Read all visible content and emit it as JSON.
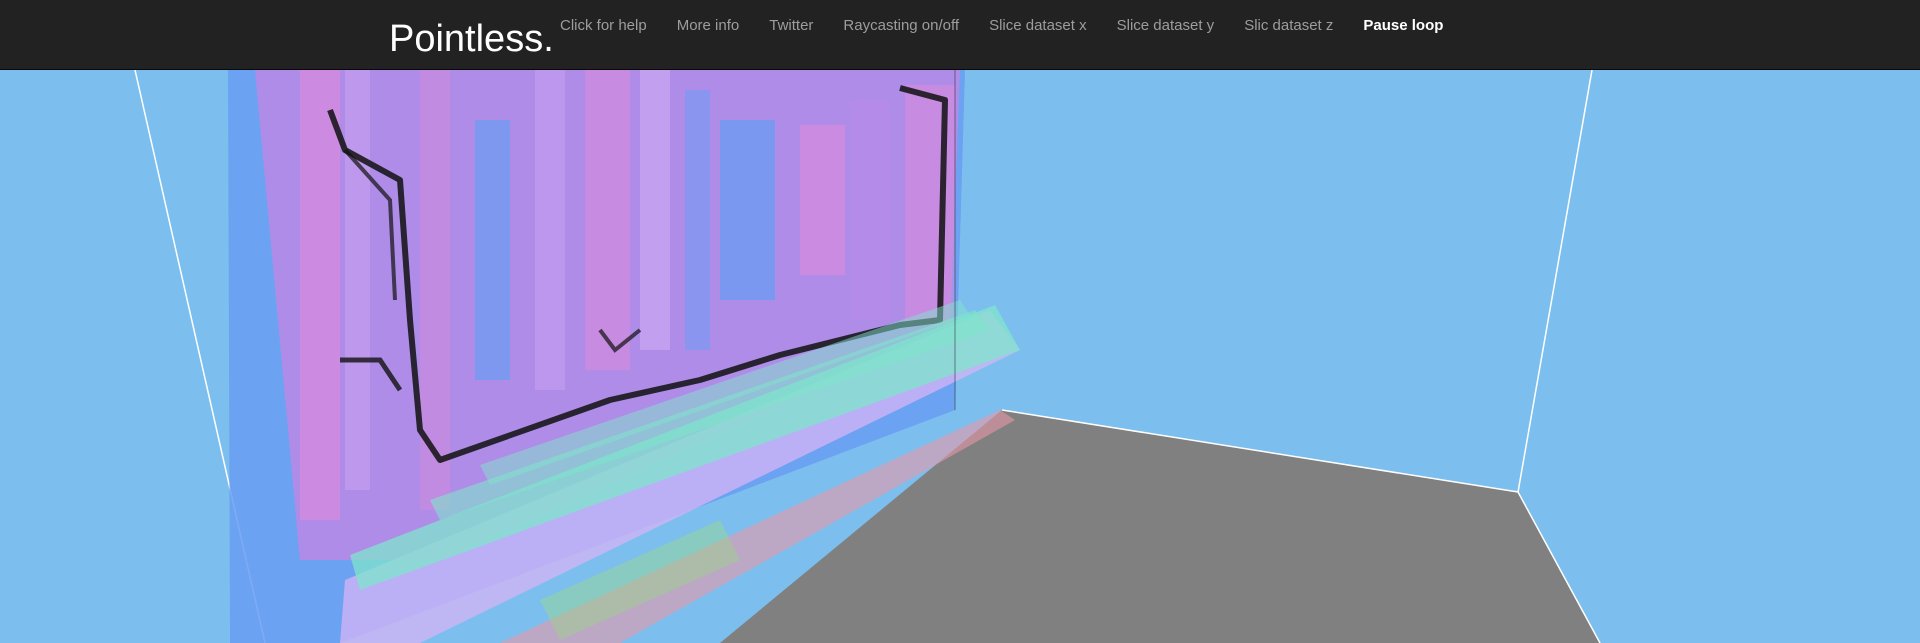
{
  "brand": "Pointless.",
  "nav": {
    "items": [
      {
        "label": "Click for help"
      },
      {
        "label": "More info"
      },
      {
        "label": "Twitter"
      },
      {
        "label": "Raycasting on/off"
      },
      {
        "label": "Slice dataset x"
      },
      {
        "label": "Slice dataset y"
      },
      {
        "label": "Slic dataset z"
      },
      {
        "label": "Pause loop"
      }
    ],
    "active_index": 7
  },
  "scene": {
    "background_color": "#7cbfee",
    "floor_color": "#808080",
    "edge_color": "#ffffff",
    "voxel_colors": [
      "#b88ae8",
      "#e48ad8",
      "#6a9cf2",
      "#7fe4cc",
      "#e898a8",
      "#101010"
    ]
  }
}
